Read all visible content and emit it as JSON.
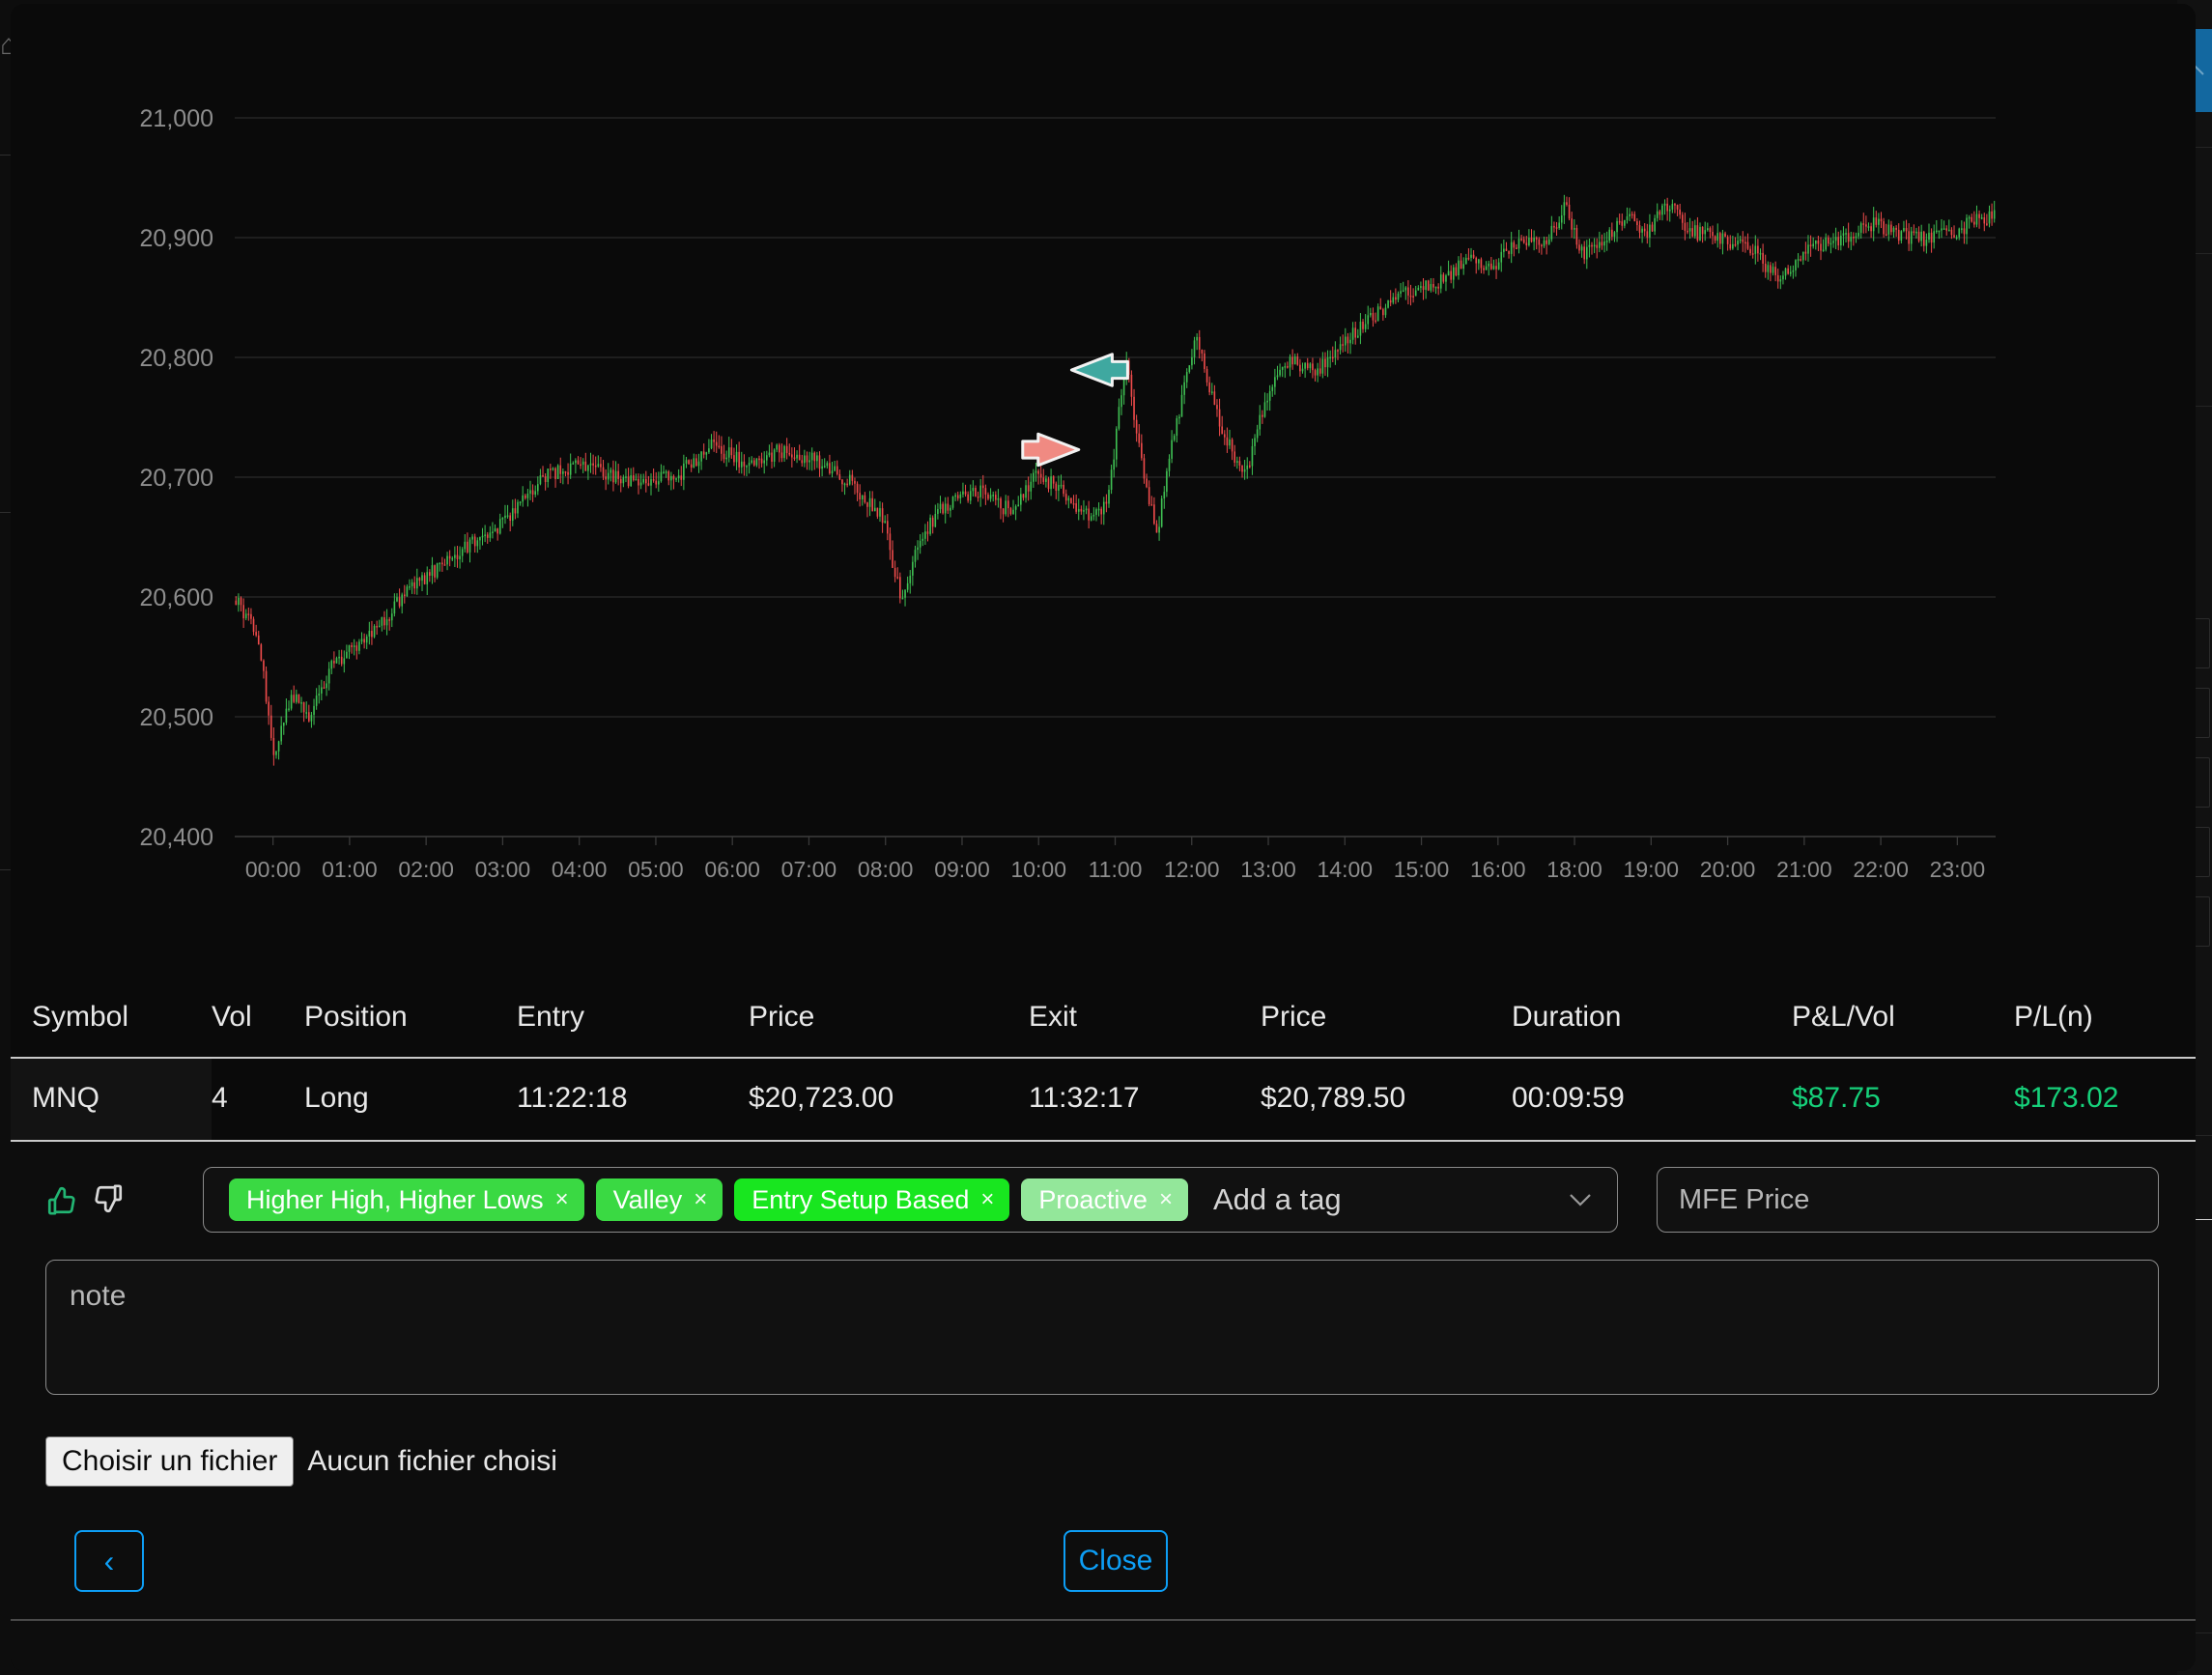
{
  "chart_data": {
    "type": "candlestick",
    "title": "",
    "xlabel": "",
    "ylabel": "",
    "ylim": [
      20400,
      21000
    ],
    "ytick_labels": [
      "21,000",
      "20,900",
      "20,800",
      "20,700",
      "20,600",
      "20,500",
      "20,400"
    ],
    "ytick_values": [
      21000,
      20900,
      20800,
      20700,
      20600,
      20500,
      20400
    ],
    "xtick_labels": [
      "00:00",
      "01:00",
      "02:00",
      "03:00",
      "04:00",
      "05:00",
      "06:00",
      "07:00",
      "08:00",
      "09:00",
      "10:00",
      "11:00",
      "12:00",
      "13:00",
      "14:00",
      "15:00",
      "16:00",
      "18:00",
      "19:00",
      "20:00",
      "21:00",
      "22:00",
      "23:00"
    ],
    "grid": "horizontal",
    "legend": "none",
    "up_color": "#3fc153",
    "down_color": "#ef4b4b",
    "annotations": [
      {
        "name": "entry-marker",
        "label": "Entry",
        "direction": "right",
        "color": "#f08a82",
        "price": 20723.0,
        "time": "11:22:18"
      },
      {
        "name": "exit-marker",
        "label": "Exit",
        "direction": "left",
        "color": "#3fa8a0",
        "price": 20789.5,
        "time": "11:32:17"
      }
    ],
    "series_note": "Intraday 1-minute MNQ candles, 00:00-23:59",
    "ohlc_summary": {
      "open": 20597,
      "day_low": 20463,
      "day_high": 20932,
      "close": 20920
    }
  },
  "table": {
    "headers": [
      "Symbol",
      "Vol",
      "Position",
      "Entry",
      "Price",
      "Exit",
      "Price",
      "Duration",
      "P&L/Vol",
      "P/L(n)"
    ],
    "rows": [
      {
        "symbol": "MNQ",
        "vol": "4",
        "position": "Long",
        "entry_time": "11:22:18",
        "entry_price": "$20,723.00",
        "exit_time": "11:32:17",
        "exit_price": "$20,789.50",
        "duration": "00:09:59",
        "pl_vol": "$87.75",
        "pl_net": "$173.02"
      }
    ]
  },
  "form": {
    "rating": {
      "thumbs_up_name": "thumbs-up-icon",
      "thumbs_down_name": "thumbs-down-icon",
      "thumbs_up_color": "#22b573",
      "thumbs_down_color": "#d8d8d8"
    },
    "tags": [
      {
        "label": "Higher High, Higher Lows",
        "remove": "×",
        "color": "#3ad943"
      },
      {
        "label": "Valley",
        "remove": "×",
        "color": "#3ad943"
      },
      {
        "label": "Entry Setup Based",
        "remove": "×",
        "color": "#18e61f"
      },
      {
        "label": "Proactive",
        "remove": "×",
        "color": "#93e79a"
      }
    ],
    "tag_input_placeholder": "Add a tag",
    "tag_input_value": "",
    "tag_dropdown_icon": "chevron-down-icon",
    "mfe_placeholder": "MFE Price",
    "mfe_value": "",
    "note_placeholder": "note",
    "note_value": "",
    "file_button_label": "Choisir un fichier",
    "file_status_label": "Aucun fichier choisi",
    "back_label": "‹",
    "close_label": "Close",
    "accent_color": "#0d9ef5"
  }
}
